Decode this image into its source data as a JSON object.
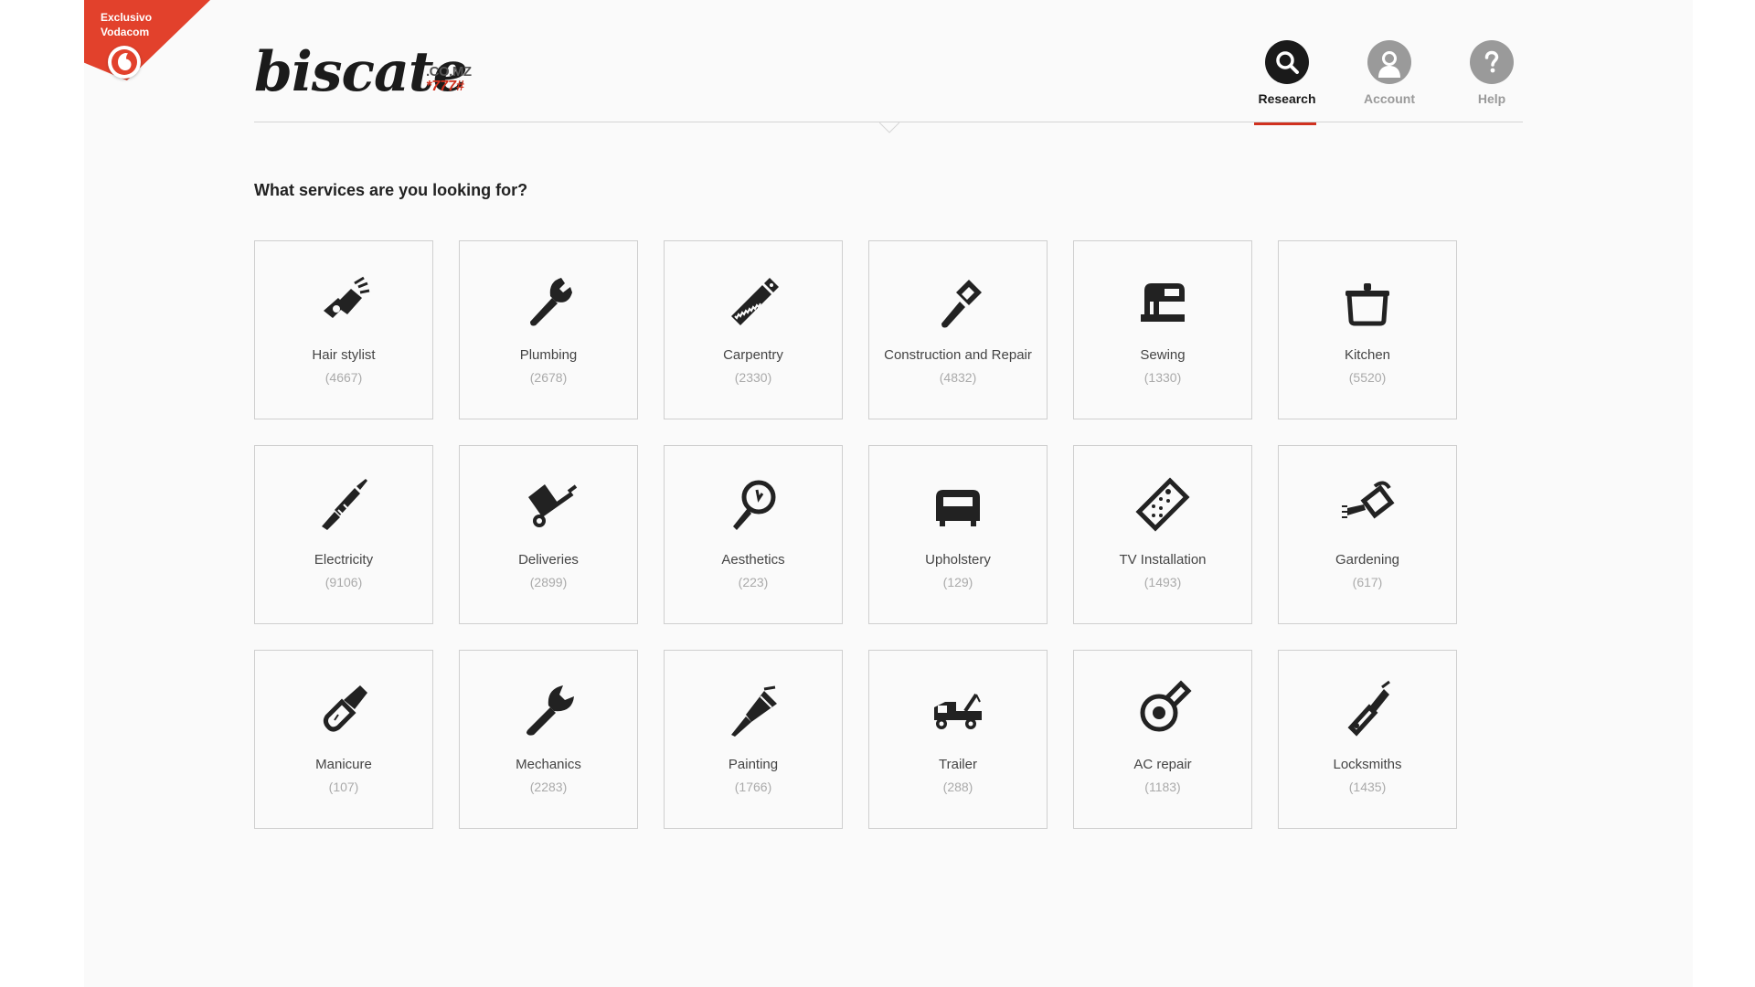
{
  "ribbon": {
    "line1": "Exclusivo",
    "line2": "Vodacom"
  },
  "brand": {
    "name": "biscate",
    "tld": ".CO.MZ",
    "code": "*777#",
    "accent": "#d0311f"
  },
  "nav": [
    {
      "label": "Research",
      "icon": "search-icon",
      "active": true
    },
    {
      "label": "Account",
      "icon": "user-icon",
      "active": false
    },
    {
      "label": "Help",
      "icon": "help-icon",
      "active": false
    }
  ],
  "question": "What services are you looking for?",
  "services": [
    {
      "title": "Hair stylist",
      "count": "(4667)",
      "icon": "hair-dryer-icon"
    },
    {
      "title": "Plumbing",
      "count": "(2678)",
      "icon": "pipe-wrench-icon"
    },
    {
      "title": "Carpentry",
      "count": "(2330)",
      "icon": "saw-icon"
    },
    {
      "title": "Construction and Repair",
      "count": "(4832)",
      "icon": "hammer-icon"
    },
    {
      "title": "Sewing",
      "count": "(1330)",
      "icon": "sewing-machine-icon"
    },
    {
      "title": "Kitchen",
      "count": "(5520)",
      "icon": "pot-icon"
    },
    {
      "title": "Electricity",
      "count": "(9106)",
      "icon": "screwdriver-icon"
    },
    {
      "title": "Deliveries",
      "count": "(2899)",
      "icon": "hand-truck-icon"
    },
    {
      "title": "Aesthetics",
      "count": "(223)",
      "icon": "mirror-icon"
    },
    {
      "title": "Upholstery",
      "count": "(129)",
      "icon": "sofa-icon"
    },
    {
      "title": "TV Installation",
      "count": "(1493)",
      "icon": "remote-control-icon"
    },
    {
      "title": "Gardening",
      "count": "(617)",
      "icon": "watering-can-icon"
    },
    {
      "title": "Manicure",
      "count": "(107)",
      "icon": "nail-polish-icon"
    },
    {
      "title": "Mechanics",
      "count": "(2283)",
      "icon": "wrench-icon"
    },
    {
      "title": "Painting",
      "count": "(1766)",
      "icon": "paint-brush-icon"
    },
    {
      "title": "Trailer",
      "count": "(288)",
      "icon": "tow-truck-icon"
    },
    {
      "title": "AC repair",
      "count": "(1183)",
      "icon": "fan-icon"
    },
    {
      "title": "Locksmiths",
      "count": "(1435)",
      "icon": "key-icon"
    }
  ]
}
